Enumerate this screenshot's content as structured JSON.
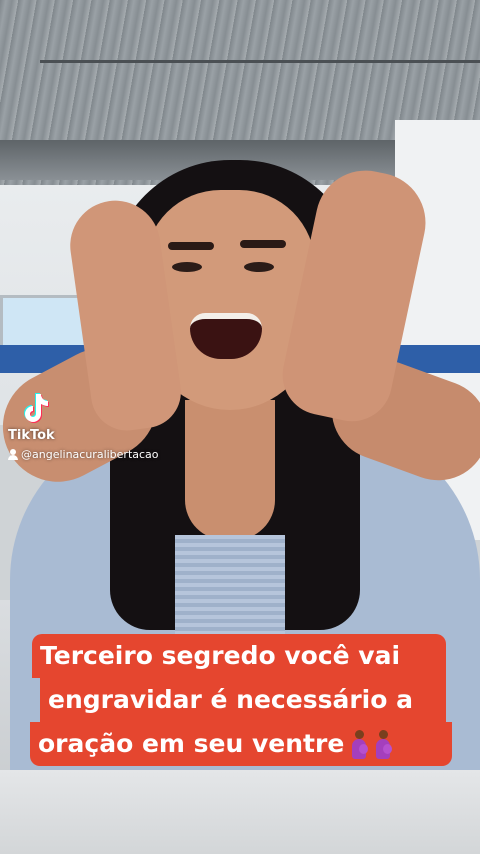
{
  "watermark": {
    "brand": "TikTok",
    "handle": "@angelinacuralibertacao",
    "logo_icon": "tiktok-logo-icon",
    "user_icon": "user-icon"
  },
  "caption": {
    "line1": "Terceiro segredo você vai",
    "line2": "engravidar é necessário a",
    "line3": "oração em seu ventre",
    "emoji": [
      "pregnant-person-icon",
      "pregnant-person-icon"
    ],
    "background_color": "#e5462f",
    "text_color": "#ffffff"
  }
}
